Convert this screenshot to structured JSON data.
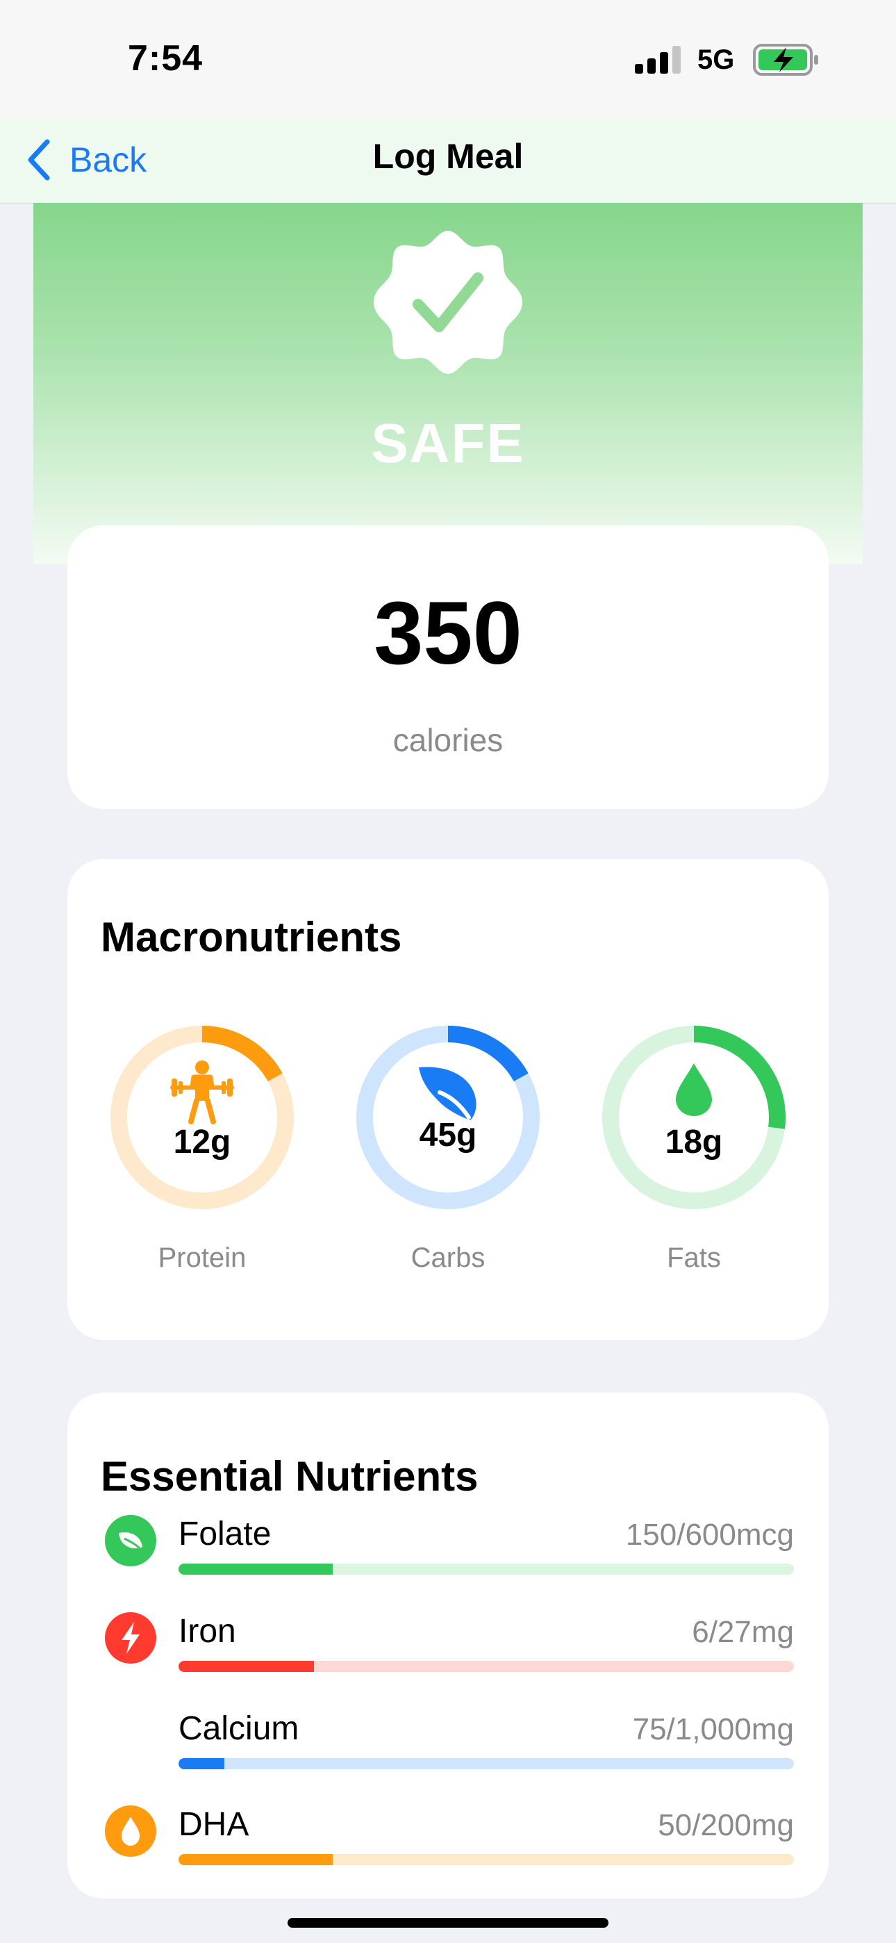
{
  "status_bar": {
    "time": "7:54",
    "network": "5G"
  },
  "nav": {
    "back_label": "Back",
    "title": "Log Meal"
  },
  "hero": {
    "status": "SAFE",
    "color": "#86d68c"
  },
  "calories": {
    "value": "350",
    "unit": "calories"
  },
  "macronutrients": {
    "title": "Macronutrients",
    "items": [
      {
        "label": "Protein",
        "value": "12g",
        "progress": 0.17,
        "color": "#ff9b0f",
        "track": "#ffe9cc",
        "icon": "weightlifter-icon"
      },
      {
        "label": "Carbs",
        "value": "45g",
        "progress": 0.17,
        "color": "#1a7cf5",
        "track": "#cfe4fd",
        "icon": "leaf-icon"
      },
      {
        "label": "Fats",
        "value": "18g",
        "progress": 0.27,
        "color": "#34c759",
        "track": "#d8f4de",
        "icon": "drop-icon"
      }
    ]
  },
  "essential_nutrients": {
    "title": "Essential Nutrients",
    "items": [
      {
        "name": "Folate",
        "amount": "150/600mcg",
        "progress": 0.25,
        "color": "#34c759",
        "track": "#dcf5e1",
        "icon": "leaf-icon"
      },
      {
        "name": "Iron",
        "amount": "6/27mg",
        "progress": 0.22,
        "color": "#ff3b30",
        "track": "#fdd8d5",
        "icon": "bolt-icon"
      },
      {
        "name": "Calcium",
        "amount": "75/1,000mg",
        "progress": 0.075,
        "color": "#1a7cf5",
        "track": "#cfe4fd",
        "icon": ""
      },
      {
        "name": "DHA",
        "amount": "50/200mg",
        "progress": 0.25,
        "color": "#ff9b0f",
        "track": "#ffe9cc",
        "icon": "drop-icon"
      }
    ]
  }
}
